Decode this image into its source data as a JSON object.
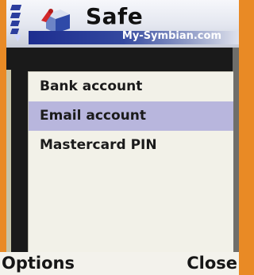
{
  "app": {
    "title": "Safe",
    "subtitle": "My-Symbian.com",
    "icon": "safe-app-icon"
  },
  "status": {
    "signal_icon": "signal-strength-icon",
    "nav_icon": "navigation-arrow-icon"
  },
  "list": {
    "items": [
      {
        "label": "Bank account",
        "selected": false
      },
      {
        "label": "Email account",
        "selected": true
      },
      {
        "label": "Mastercard PIN",
        "selected": false
      }
    ]
  },
  "softkeys": {
    "left": "Options",
    "right": "Close"
  },
  "colors": {
    "accent": "#e98a25",
    "selection": "#b8b6dd",
    "title_strip": "#1d2d8f"
  }
}
